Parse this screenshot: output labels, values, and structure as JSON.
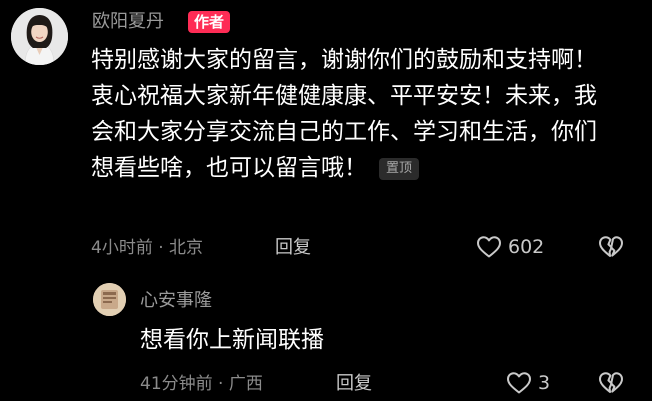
{
  "comment": {
    "author": "欧阳夏丹",
    "author_badge": "作者",
    "text": "特别感谢大家的留言，谢谢你们的鼓励和支持啊！衷心祝福大家新年健健康康、平平安安！未来，我会和大家分享交流自己的工作、学习和生活，你们想看些啥，也可以留言哦！",
    "pin_label": "置顶",
    "time": "4小时前",
    "location": "北京",
    "reply_label": "回复",
    "likes": "602"
  },
  "reply": {
    "author": "心安事隆",
    "text": "想看你上新闻联播",
    "time": "41分钟前",
    "location": "广西",
    "reply_label": "回复",
    "likes": "3"
  },
  "icons": {
    "like": "heart-outline-icon",
    "dislike": "broken-heart-icon"
  },
  "colors": {
    "background": "#000000",
    "author_badge": "#fe2c55",
    "primary_text": "#ffffff",
    "secondary_text": "#8b8b8b"
  }
}
